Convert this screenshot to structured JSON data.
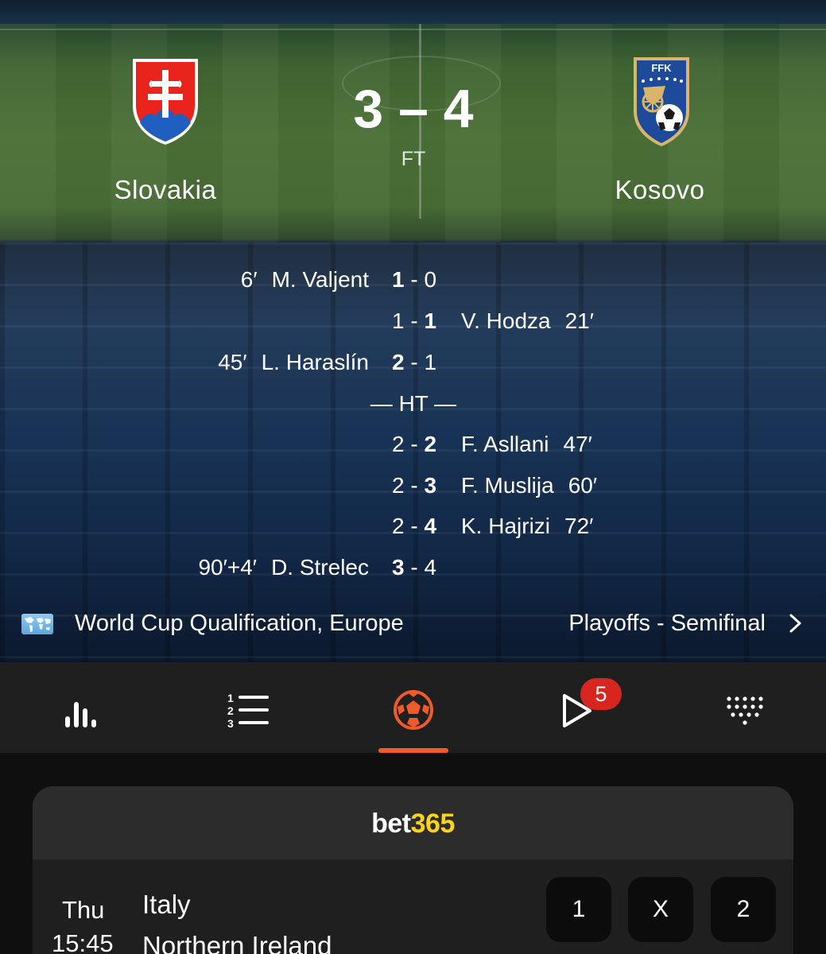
{
  "match": {
    "home": {
      "name": "Slovakia",
      "flag": "slovakia-coat-of-arms"
    },
    "away": {
      "name": "Kosovo",
      "flag": "ffk-crest",
      "crest_text": "FFK"
    },
    "score": "3 – 4",
    "status": "FT"
  },
  "events": [
    {
      "side": "home",
      "minute": "6′",
      "player": "M. Valjent",
      "home_score": "1",
      "away_score": "0"
    },
    {
      "side": "away",
      "minute": "21′",
      "player": "V. Hodza",
      "home_score": "1",
      "away_score": "1"
    },
    {
      "side": "home",
      "minute": "45′",
      "player": "L. Haraslín",
      "home_score": "2",
      "away_score": "1"
    },
    {
      "side": "away",
      "minute": "47′",
      "player": "F. Asllani",
      "home_score": "2",
      "away_score": "2"
    },
    {
      "side": "away",
      "minute": "60′",
      "player": "F. Muslija",
      "home_score": "2",
      "away_score": "3"
    },
    {
      "side": "away",
      "minute": "72′",
      "player": "K. Hajrizi",
      "home_score": "2",
      "away_score": "4"
    },
    {
      "side": "home",
      "minute": "90′+4′",
      "player": "D. Strelec",
      "home_score": "3",
      "away_score": "4"
    }
  ],
  "halftime_label": "— HT —",
  "competition": {
    "name": "World Cup Qualification, Europe",
    "round": "Playoffs - Semifinal",
    "icon": "world-map-icon"
  },
  "tabs": [
    {
      "name": "stats",
      "icon": "bar-chart-icon"
    },
    {
      "name": "standings",
      "icon": "numbered-list-icon"
    },
    {
      "name": "match",
      "icon": "soccer-ball-icon",
      "active": true
    },
    {
      "name": "videos",
      "icon": "play-icon",
      "badge": "5"
    },
    {
      "name": "lineups",
      "icon": "formation-dots-icon"
    }
  ],
  "colors": {
    "accent": "#ef5a29",
    "badge": "#d7261f",
    "bet_yellow": "#ffd31a",
    "tab_bg": "#1f1f1f"
  },
  "betting": {
    "brand_part1": "bet",
    "brand_part2": "365",
    "fixture": {
      "day": "Thu",
      "time": "15:45",
      "home": "Italy",
      "away": "Northern Ireland",
      "odds_labels": [
        "1",
        "X",
        "2"
      ]
    }
  }
}
